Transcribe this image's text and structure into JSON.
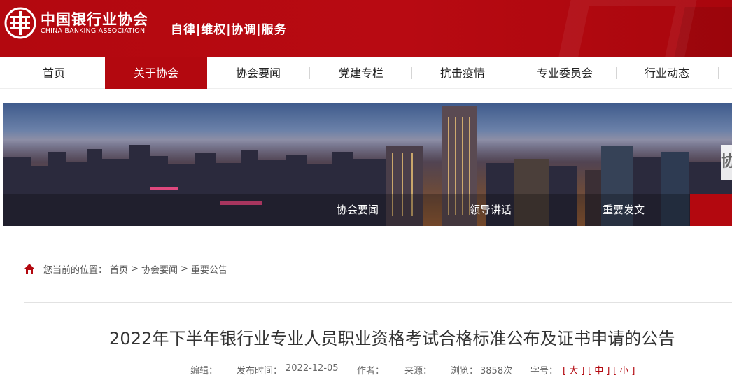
{
  "header": {
    "name_cn": "中国银行业协会",
    "name_en": "CHINA BANKING ASSOCIATION",
    "slogan": "自律|维权|协调|服务"
  },
  "nav": {
    "items": [
      "首页",
      "关于协会",
      "协会要闻",
      "党建专栏",
      "抗击疫情",
      "专业委员会",
      "行业动态"
    ],
    "active_index": 1
  },
  "banner": {
    "tabs": [
      "协会要闻",
      "领导讲话",
      "重要发文"
    ],
    "side_text": "协"
  },
  "breadcrumb": {
    "prefix": "您当前的位置：",
    "items": [
      "首页",
      ">",
      "协会要闻",
      ">",
      "重要公告"
    ]
  },
  "article": {
    "title": "2022年下半年银行业专业人员职业资格考试合格标准公布及证书申请的公告",
    "meta": {
      "editor_label": "编辑：",
      "publish_label": "发布时间：",
      "publish_date": "2022-12-05",
      "author_label": "作者：",
      "source_label": "来源：",
      "views_label": "浏览：",
      "views_value": "3858次",
      "font_label": "字号：",
      "font_large": "[ 大 ]",
      "font_medium": "[ 中 ]",
      "font_small": "[ 小 ]"
    }
  },
  "colors": {
    "brand_red": "#b3080f"
  }
}
